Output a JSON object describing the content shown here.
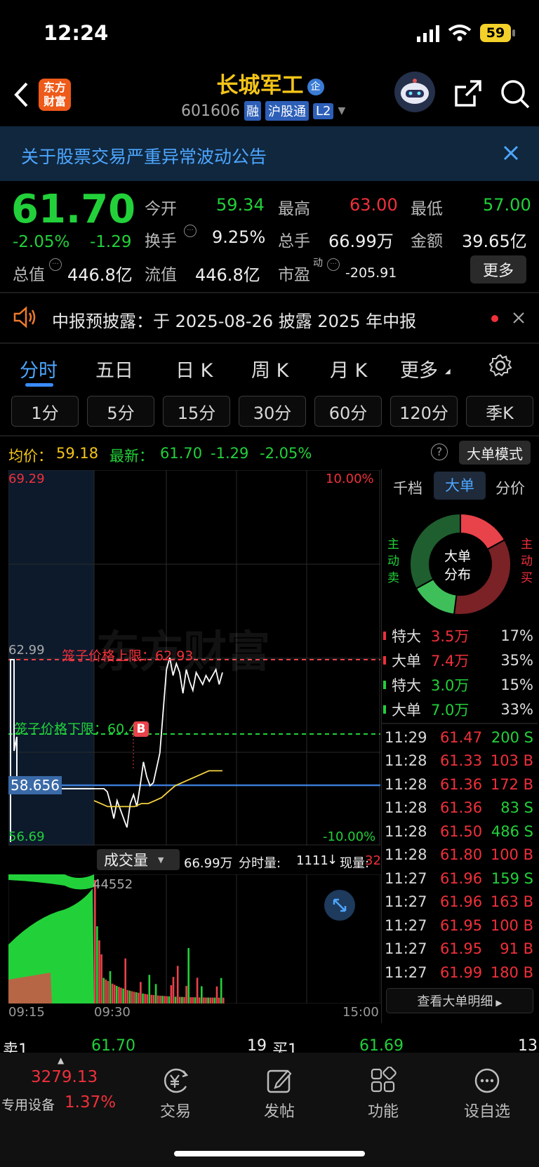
{
  "status_bar": {
    "time": "12:24",
    "battery": "59"
  },
  "header": {
    "logo_line1": "东方",
    "logo_line2": "财富",
    "title": "长城军工",
    "title_badge": "企",
    "code": "601606",
    "tag_rong": "融",
    "tag_hgt": "沪股通",
    "tag_l2": "L2"
  },
  "notice": {
    "text": "关于股票交易严重异常波动公告"
  },
  "quote": {
    "price": "61.70",
    "pct": "-2.05%",
    "chg": "-1.29",
    "open_label": "今开",
    "open": "59.34",
    "high_label": "最高",
    "high": "63.00",
    "low_label": "最低",
    "low": "57.00",
    "turnover_label": "换手",
    "turnover": "9.25%",
    "volume_label": "总手",
    "volume": "66.99万",
    "amount_label": "金额",
    "amount": "39.65亿",
    "mcap_label": "总值",
    "mcap": "446.8亿",
    "float_label": "流值",
    "float": "446.8亿",
    "pe_label": "市盈",
    "pe_sup": "动",
    "pe": "-205.91",
    "more_button": "更多"
  },
  "announcement": {
    "text": "中报预披露：于 2025-08-26 披露 2025 年中报"
  },
  "tabs": [
    {
      "label": "分时",
      "active": true
    },
    {
      "label": "五日"
    },
    {
      "label": "日 K"
    },
    {
      "label": "周 K"
    },
    {
      "label": "月 K"
    },
    {
      "label": "更多"
    }
  ],
  "periods": [
    "1分",
    "5分",
    "15分",
    "30分",
    "60分",
    "120分",
    "季K"
  ],
  "infobar": {
    "avg_label": "均价：",
    "avg": "59.18",
    "latest_label": "最新：",
    "latest": "61.70",
    "chg": "-1.29",
    "pct": "-2.05%",
    "help": "?",
    "mode_button": "大单模式"
  },
  "chart": {
    "y_top": "69.29",
    "y_bottom": "56.69",
    "pct_top": "10.00%",
    "pct_bottom": "-10.00%",
    "ref_price": "62.99",
    "upper_limit_label": "笼子价格上限：62.93",
    "lower_limit_label": "笼子价格下限：60.46",
    "current_tag": "58.656",
    "marker_b": "B",
    "watermark": "东方财富"
  },
  "chart_data": {
    "type": "line",
    "x_start": "09:15",
    "x_open": "09:30",
    "x_end": "15:00",
    "price_series": {
      "name": "价格",
      "values": [
        58.6,
        58.6,
        58.6,
        58.6,
        58.5,
        58.1,
        57.6,
        58.2,
        57.9,
        57.6,
        57.3,
        58.1,
        58.4,
        58.0,
        58.7,
        59.5,
        59.0,
        58.7,
        58.8,
        59.3,
        59.8,
        61.2,
        62.6,
        63.0,
        62.4,
        62.8,
        62.5,
        61.8,
        62.6,
        62.2,
        61.9,
        62.5,
        62.3,
        62.1,
        62.4,
        62.2,
        62.4,
        62.6,
        62.1,
        62.5
      ]
    },
    "avg_series": {
      "name": "均价",
      "values": [
        58.2,
        58.1,
        58.0,
        58.0,
        58.0,
        58.0,
        58.0,
        58.1,
        58.1,
        58.2,
        58.3,
        58.5,
        58.7,
        58.8,
        58.9,
        59.0,
        59.1,
        59.2,
        59.2,
        59.2
      ]
    }
  },
  "volume": {
    "selector": "成交量",
    "total": "66.99万",
    "fen_label": "分时量:",
    "fen_value": "1111",
    "arrow": "↓",
    "now_label": "现量:",
    "now_value": "32",
    "peak": "44552",
    "time_start": "09:15",
    "time_open": "09:30",
    "time_end": "15:00"
  },
  "side_panel": {
    "tabs": [
      {
        "label": "千档"
      },
      {
        "label": "大单",
        "active": true
      },
      {
        "label": "分价"
      }
    ],
    "donut_center_line1": "大单",
    "donut_center_line2": "分布",
    "left_label": [
      "主",
      "动",
      "卖"
    ],
    "right_label": [
      "主",
      "动",
      "买"
    ],
    "donut_slices": [
      {
        "name": "特大买",
        "pct": 17,
        "color": "#e8424a"
      },
      {
        "name": "大单买",
        "pct": 35,
        "color": "#7a2226"
      },
      {
        "name": "特大卖",
        "pct": 15,
        "color": "#3fbf5a"
      },
      {
        "name": "大单卖",
        "pct": 33,
        "color": "#1f5e2e"
      }
    ],
    "summary": [
      {
        "label": "特大",
        "amount": "3.5万",
        "pct": "17%",
        "color": "#f0303a"
      },
      {
        "label": "大单",
        "amount": "7.4万",
        "pct": "35%",
        "color": "#f0303a"
      },
      {
        "label": "特大",
        "amount": "3.0万",
        "pct": "15%",
        "color": "#22d13a"
      },
      {
        "label": "大单",
        "amount": "7.0万",
        "pct": "33%",
        "color": "#22d13a"
      }
    ],
    "trades": [
      {
        "t": "11:29",
        "p": "61.47",
        "pc": "#f0303a",
        "v": "200 S",
        "vc": "#22d13a"
      },
      {
        "t": "11:28",
        "p": "61.33",
        "pc": "#f0303a",
        "v": "103 B",
        "vc": "#f0303a"
      },
      {
        "t": "11:28",
        "p": "61.36",
        "pc": "#f0303a",
        "v": "172 B",
        "vc": "#f0303a"
      },
      {
        "t": "11:28",
        "p": "61.36",
        "pc": "#f0303a",
        "v": "83 S",
        "vc": "#22d13a"
      },
      {
        "t": "11:28",
        "p": "61.50",
        "pc": "#f0303a",
        "v": "486 S",
        "vc": "#22d13a"
      },
      {
        "t": "11:28",
        "p": "61.80",
        "pc": "#f0303a",
        "v": "100 B",
        "vc": "#f0303a"
      },
      {
        "t": "11:27",
        "p": "61.96",
        "pc": "#f0303a",
        "v": "159 S",
        "vc": "#22d13a"
      },
      {
        "t": "11:27",
        "p": "61.96",
        "pc": "#f0303a",
        "v": "163 B",
        "vc": "#f0303a"
      },
      {
        "t": "11:27",
        "p": "61.95",
        "pc": "#f0303a",
        "v": "100 B",
        "vc": "#f0303a"
      },
      {
        "t": "11:27",
        "p": "61.95",
        "pc": "#f0303a",
        "v": "91 B",
        "vc": "#f0303a"
      },
      {
        "t": "11:27",
        "p": "61.99",
        "pc": "#f0303a",
        "v": "180 B",
        "vc": "#f0303a"
      }
    ],
    "detail_button": "查看大单明细"
  },
  "orderbook": {
    "sell_label": "卖1",
    "sell_price": "61.70",
    "sell_vol": "19",
    "buy_label": "买1",
    "buy_price": "61.69",
    "buy_vol": "13"
  },
  "bottom_nav": {
    "index_value": "3279.13",
    "index_label": "专用设备",
    "index_pct": "1.37%",
    "items": [
      {
        "label": "交易",
        "icon": "yen-icon"
      },
      {
        "label": "发帖",
        "icon": "edit-icon"
      },
      {
        "label": "功能",
        "icon": "grid-icon"
      },
      {
        "label": "设自选",
        "icon": "more-icon"
      }
    ]
  }
}
